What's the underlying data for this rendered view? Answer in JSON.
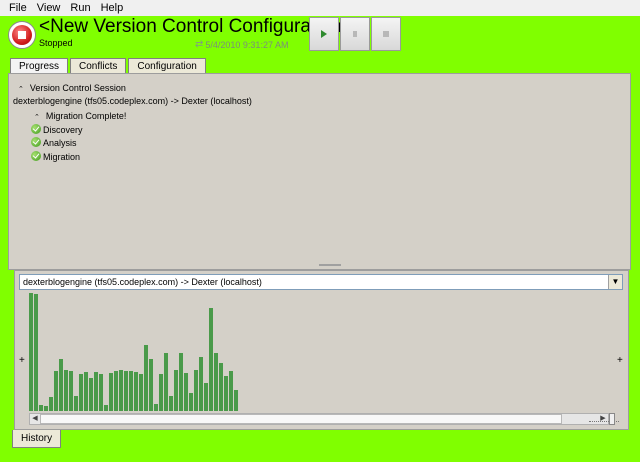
{
  "menu": [
    "File",
    "View",
    "Run",
    "Help"
  ],
  "header": {
    "title": "<New Version Control Configuration>",
    "status": "Stopped",
    "timestamp": "5/4/2010 9:31:27 AM",
    "accent_color": "#80ff00"
  },
  "tabs": [
    {
      "label": "Progress",
      "active": true
    },
    {
      "label": "Conflicts",
      "active": false
    },
    {
      "label": "Configuration",
      "active": false
    }
  ],
  "progress": {
    "session_label": "Version Control Session",
    "session_path": "dexterblogengine (tfs05.codeplex.com) -> Dexter (localhost)",
    "migration_label": "Migration Complete!",
    "steps": [
      "Discovery",
      "Analysis",
      "Migration"
    ]
  },
  "history": {
    "selected_session": "dexterblogengine (tfs05.codeplex.com) -> Dexter (localhost)",
    "tab_label": "History",
    "plus": "+",
    "bar_values": [
      100,
      99,
      5,
      4,
      12,
      34,
      44,
      35,
      34,
      13,
      31,
      33,
      28,
      33,
      31,
      5,
      32,
      34,
      35,
      34,
      34,
      33,
      31,
      56,
      44,
      6,
      31,
      49,
      13,
      35,
      49,
      32,
      15,
      35,
      46,
      24,
      87,
      49,
      41,
      30,
      34,
      18
    ]
  }
}
